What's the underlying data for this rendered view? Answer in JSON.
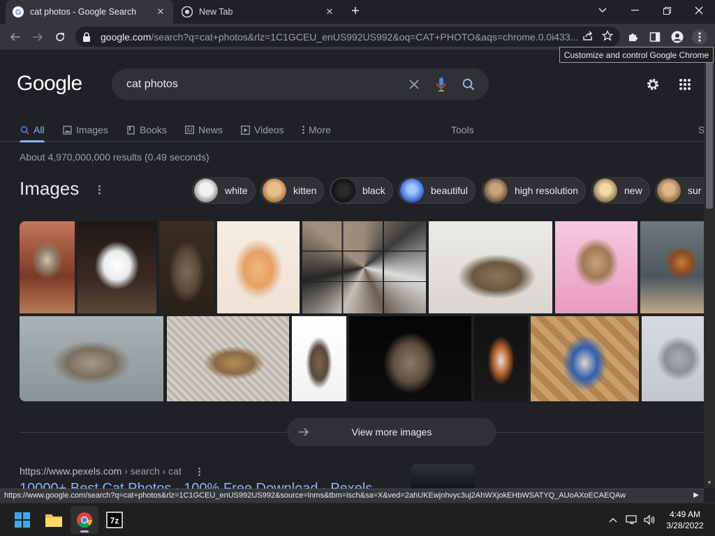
{
  "browser": {
    "tabs": [
      {
        "title": "cat photos - Google Search",
        "active": true
      },
      {
        "title": "New Tab",
        "active": false
      }
    ],
    "address": {
      "host": "google.com",
      "path": "/search?q=cat+photos&rlz=1C1GCEU_enUS992US992&oq=CAT+PHOTO&aqs=chrome.0.0i433..."
    },
    "tooltip": "Customize and control Google Chrome",
    "status_url": "https://www.google.com/search?q=cat+photos&rlz=1C1GCEU_enUS992US992&source=lnms&tbm=isch&sa=X&ved=2ahUKEwjnhvyc3uj2AhWXjokEHbWSATYQ_AUoAXoECAEQAw"
  },
  "search": {
    "logo": "Google",
    "query": "cat photos",
    "tabs": [
      {
        "label": "All",
        "icon": "search-icon",
        "selected": true
      },
      {
        "label": "Images",
        "icon": "image-icon"
      },
      {
        "label": "Books",
        "icon": "book-icon"
      },
      {
        "label": "News",
        "icon": "news-icon"
      },
      {
        "label": "Videos",
        "icon": "video-icon"
      },
      {
        "label": "More",
        "icon": "kebab-icon"
      }
    ],
    "tools_label": "Tools",
    "safe_label": "S",
    "stats": "About 4,970,000,000 results (0.49 seconds)"
  },
  "images": {
    "heading": "Images",
    "chips": [
      "white",
      "kitten",
      "black",
      "beautiful",
      "high resolution",
      "new",
      "sur"
    ],
    "view_more": "View more images"
  },
  "result": {
    "url": "https://www.pexels.com",
    "crumbs": " › search › cat",
    "title": "10000+ Best Cat Photos · 100% Free Download · Pexels"
  },
  "taskbar": {
    "time": "4:49 AM",
    "date": "3/28/2022",
    "apps": [
      "start-icon",
      "file-explorer-icon",
      "chrome-icon",
      "7zip-icon"
    ]
  },
  "colors": {
    "page_bg": "#202124",
    "link": "#8ab4f8",
    "chip_bg": "#303134"
  }
}
